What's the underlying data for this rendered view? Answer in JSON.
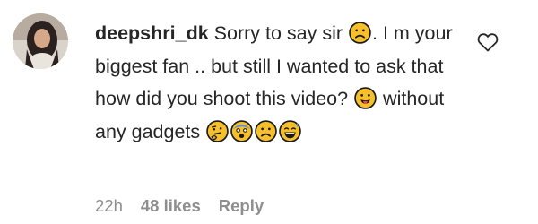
{
  "comment": {
    "username": "deepshri_dk",
    "segments": {
      "t1": "Sorry to say sir",
      "t2": ". I m your biggest fan .. but still I wanted to ask that how did you shoot this video?",
      "t3": "without any gadgets"
    },
    "emojis": {
      "e1": "frowning-face",
      "e2": "face-with-tongue",
      "e3": "thinking-face",
      "e4": "fearful-face",
      "e5": "frowning-face",
      "e6": "grinning-sweat-face"
    },
    "time": "22h",
    "likes": "48 likes",
    "reply_label": "Reply"
  },
  "colors": {
    "text": "#262626",
    "meta": "#8e8e8e",
    "emoji_yellow": "#f7c02b",
    "emoji_outline": "#1a1a1a"
  }
}
